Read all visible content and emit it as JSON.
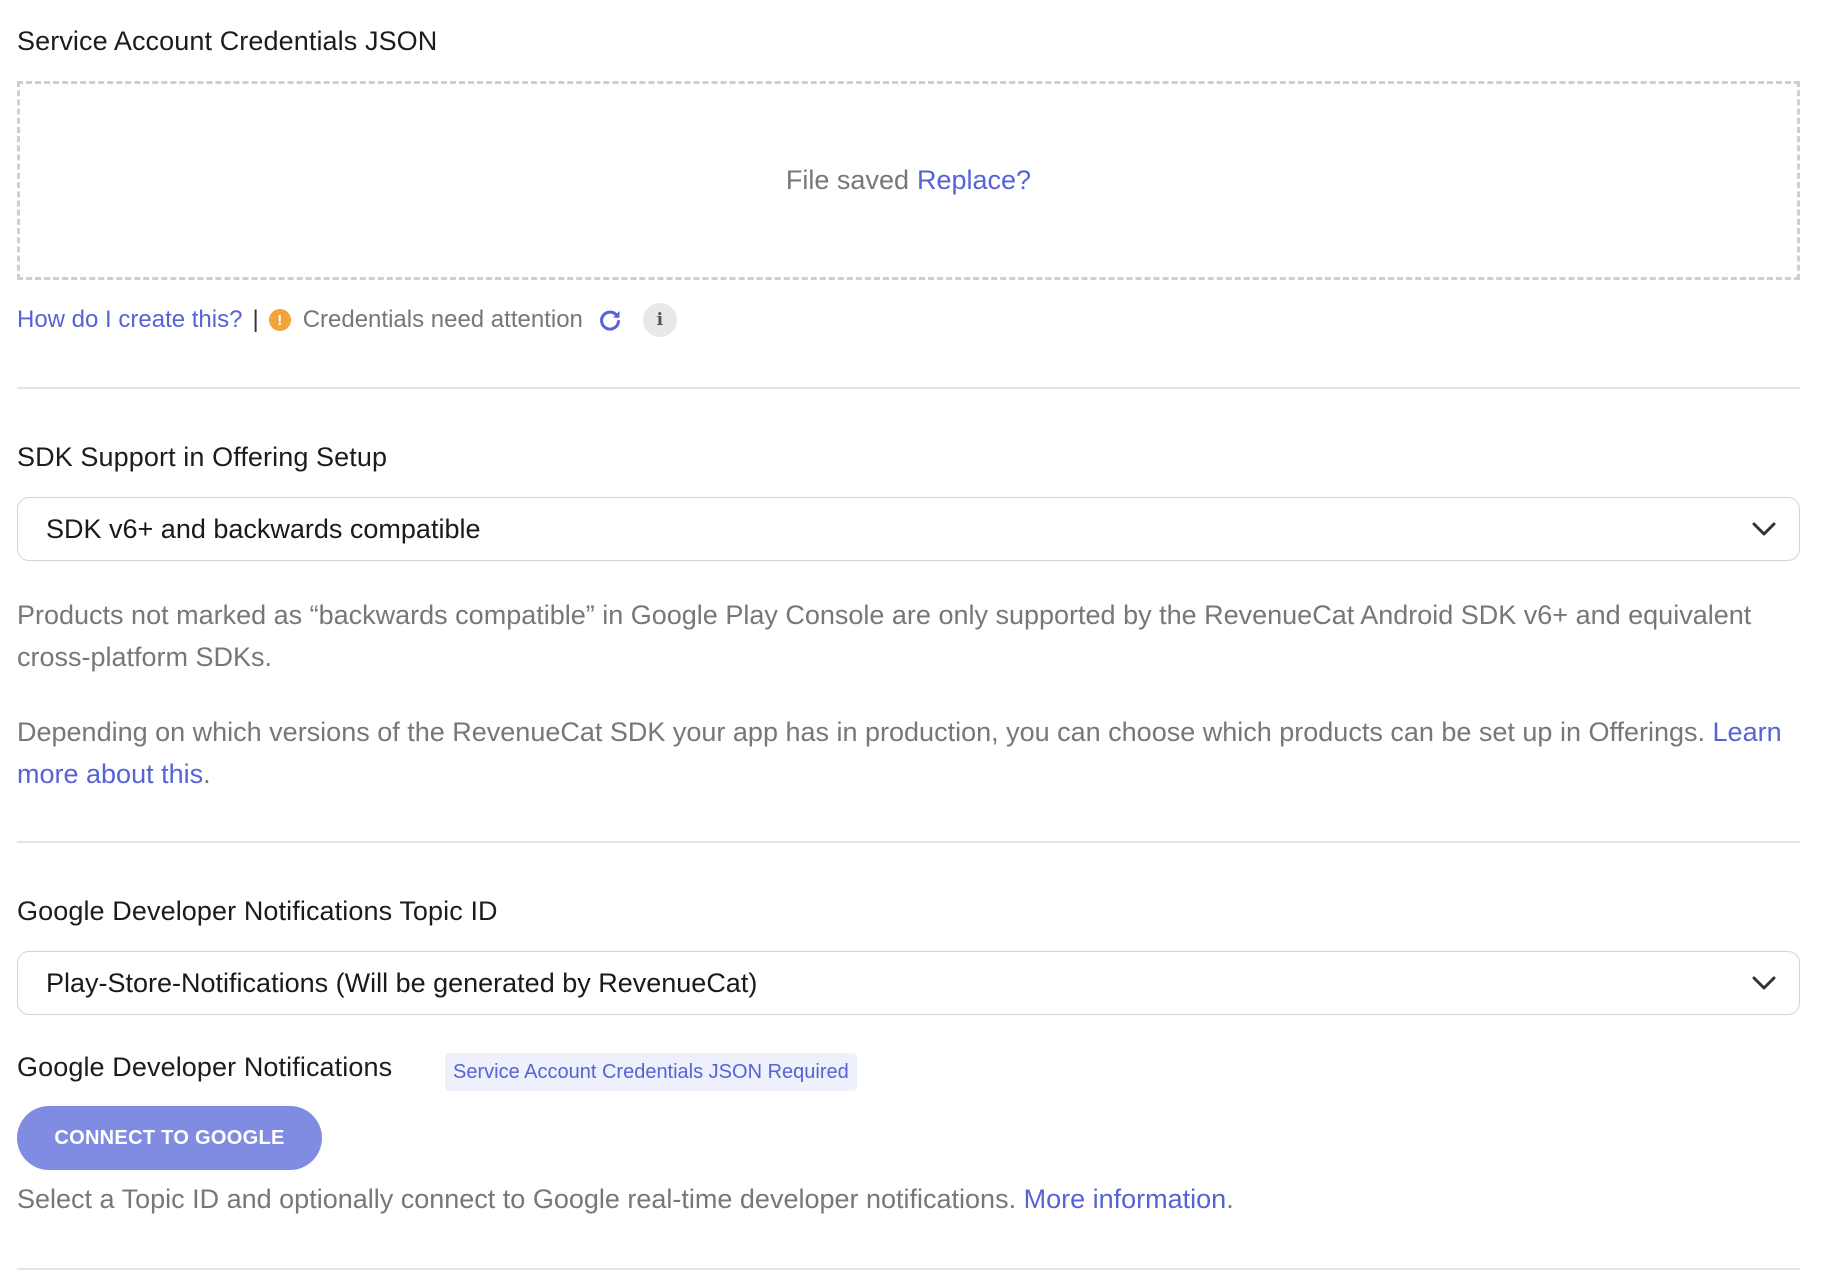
{
  "credentials": {
    "label": "Service Account Credentials JSON",
    "file_status": "File saved",
    "replace_link": "Replace?",
    "help_link": "How do I create this?",
    "separator": "|",
    "warning_icon_glyph": "!",
    "status_text": "Credentials need attention",
    "info_icon_glyph": "i",
    "warning_color": "#f2a33a"
  },
  "sdk_support": {
    "label": "SDK Support in Offering Setup",
    "selected": "SDK v6+ and backwards compatible",
    "para1": "Products not marked as “backwards compatible” in Google Play Console are only supported by the RevenueCat Android SDK v6+ and equivalent cross-platform SDKs.",
    "para2_text": "Depending on which versions of the RevenueCat SDK your app has in production, you can choose which products can be set up in Offerings.",
    "para2_link": "Learn more about this",
    "para2_end": "."
  },
  "topic": {
    "label": "Google Developer Notifications Topic ID",
    "selected": "Play-Store-Notifications (Will be generated by RevenueCat)"
  },
  "notifications": {
    "label": "Google Developer Notifications",
    "badge": "Service Account Credentials JSON Required",
    "button": "CONNECT TO GOOGLE",
    "desc_text": "Select a Topic ID and optionally connect to Google real-time developer notifications.",
    "desc_link": "More information",
    "desc_end": "."
  },
  "colors": {
    "link": "#5563d6",
    "button": "#7f8ce1",
    "muted_text": "#777777"
  },
  "icons": [
    "warning-icon",
    "refresh-icon",
    "info-icon",
    "chevron-down-icon"
  ]
}
